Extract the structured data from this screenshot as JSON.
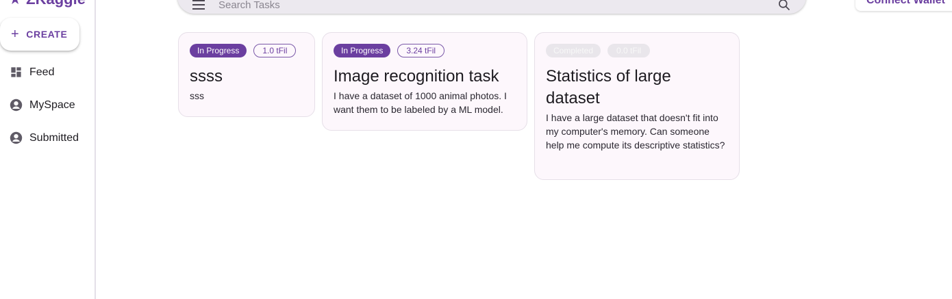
{
  "app": {
    "name": "ZKaggle"
  },
  "sidebar": {
    "create_label": "CREATE",
    "items": [
      {
        "label": "Feed",
        "icon": "dashboard-icon"
      },
      {
        "label": "MySpace",
        "icon": "account-circle-icon"
      },
      {
        "label": "Submitted",
        "icon": "account-circle-icon"
      }
    ]
  },
  "search": {
    "placeholder": "Search Tasks"
  },
  "header": {
    "wallet_label": "Connect Wallet"
  },
  "colors": {
    "accent": "#6b3fa0",
    "card_bg": "#fdf7fc"
  },
  "tasks": [
    {
      "status": "In Progress",
      "reward": "1.0 tFil",
      "title": "ssss",
      "description": "sss"
    },
    {
      "status": "In Progress",
      "reward": "3.24 tFil",
      "title": "Image recognition task",
      "description": "I have a dataset of 1000 animal photos. I want them to be labeled by a ML model."
    },
    {
      "status": "Completed",
      "reward": "0.0 tFil",
      "title": "Statistics of large dataset",
      "description": "I have a large dataset that doesn't fit into my computer's memory. Can someone help me compute its descriptive statistics?"
    }
  ]
}
